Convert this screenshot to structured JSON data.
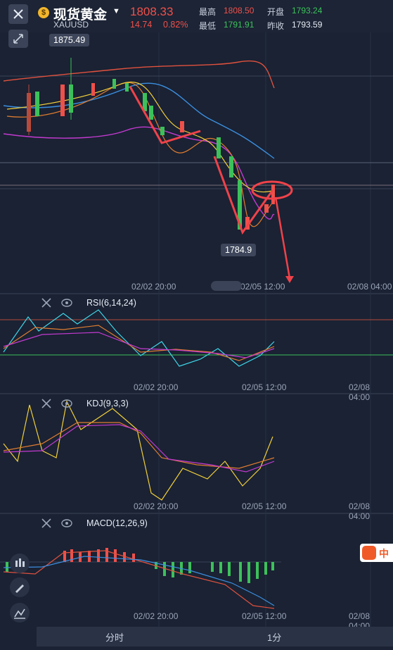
{
  "header": {
    "title": "现货黄金",
    "symbol": "XAUUSD",
    "coin_glyph": "$",
    "price": "1808.33",
    "change": "14.74",
    "change_pct": "0.82%",
    "high_label": "最高",
    "high_value": "1808.50",
    "open_label": "开盘",
    "open_value": "1793.24",
    "low_label": "最低",
    "low_value": "1791.91",
    "prevclose_label": "昨收",
    "prevclose_value": "1793.59"
  },
  "main_chart": {
    "high_tag": "1875.49",
    "low_tag": "1784.9",
    "x_labels": [
      "02/02 20:00",
      "02/05 12:00",
      "02/08 04:00"
    ]
  },
  "rsi": {
    "label": "RSI(6,14,24)",
    "x_labels": [
      "02/02 20:00",
      "02/05 12:00",
      "02/08 04:00"
    ]
  },
  "kdj": {
    "label": "KDJ(9,3,3)",
    "x_labels": [
      "02/02 20:00",
      "02/05 12:00",
      "02/08 04:00"
    ]
  },
  "macd": {
    "label": "MACD(12,26,9)",
    "x_labels": [
      "02/02 20:00",
      "02/05 12:00",
      "02/08 04:00"
    ]
  },
  "footer": {
    "tab_timeshare": "分时",
    "tab_1min": "1分"
  },
  "logo_text": "中",
  "colors": {
    "up": "#f0504a",
    "down": "#3cc15a",
    "bg": "#1a2233",
    "annotation": "#f0424a"
  },
  "icons": [
    "close-icon",
    "shrink-icon",
    "coin-icon",
    "caret-down-icon",
    "eye-icon",
    "candle-icon",
    "pencil-icon",
    "chart-tool-icon"
  ]
}
